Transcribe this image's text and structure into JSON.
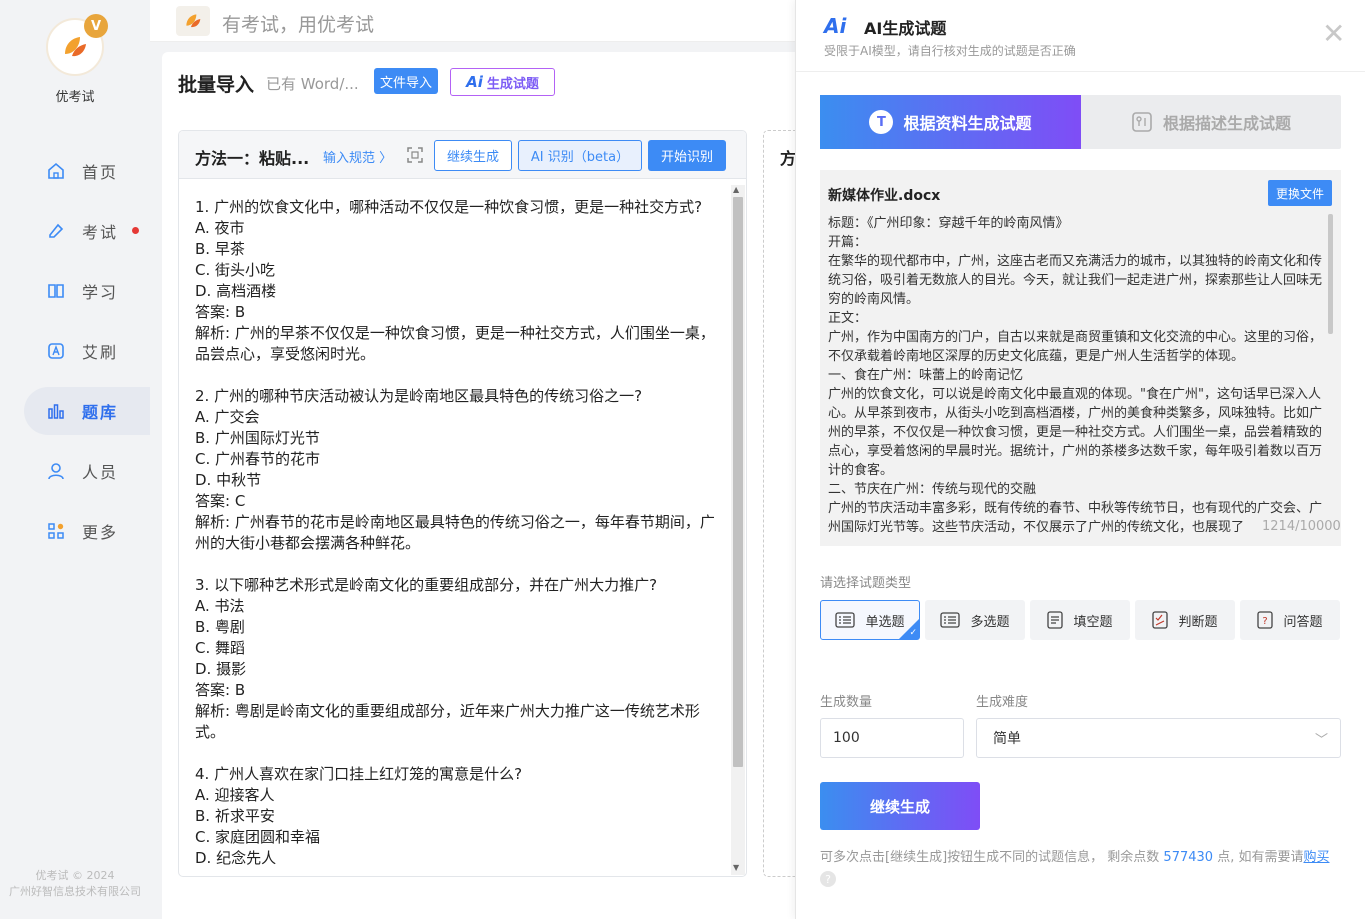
{
  "app": {
    "name": "优考试",
    "slogan": "有考试，用优考试"
  },
  "sidebar": {
    "items": [
      {
        "label": "首页",
        "icon": "home-icon"
      },
      {
        "label": "考试",
        "icon": "exam-icon",
        "dot": true
      },
      {
        "label": "学习",
        "icon": "book-icon"
      },
      {
        "label": "艾刷",
        "icon": "practice-icon"
      },
      {
        "label": "题库",
        "icon": "chart-icon",
        "active": true
      },
      {
        "label": "人员",
        "icon": "user-icon"
      },
      {
        "label": "更多",
        "icon": "more-icon"
      }
    ],
    "footer_copyright": "优考试 © 2024",
    "footer_company": "广州好智信息技术有限公司"
  },
  "main": {
    "title": "批量导入",
    "subtitle": "已有 Word/...",
    "import_button": "文件导入",
    "ai_button": "生成试题",
    "method1": {
      "title": "方法一：粘贴...",
      "spec_link": "输入规范 〉",
      "continue_button": "继续生成",
      "ai_recognize_button": "AI 识别（beta）",
      "start_button": "开始识别",
      "lines": [
        "1. 广州的饮食文化中，哪种活动不仅仅是一种饮食习惯，更是一种社交方式?",
        "A. 夜市",
        "B. 早茶",
        "C. 街头小吃",
        "D. 高档酒楼",
        "答案: B",
        "解析: 广州的早茶不仅仅是一种饮食习惯，更是一种社交方式，人们围坐一桌，品尝点心，享受悠闲时光。",
        "",
        "2. 广州的哪种节庆活动被认为是岭南地区最具特色的传统习俗之一?",
        "A. 广交会",
        "B. 广州国际灯光节",
        "C. 广州春节的花市",
        "D. 中秋节",
        "答案: C",
        "解析: 广州春节的花市是岭南地区最具特色的传统习俗之一，每年春节期间，广州的大街小巷都会摆满各种鲜花。",
        "",
        "3. 以下哪种艺术形式是岭南文化的重要组成部分，并在广州大力推广?",
        "A. 书法",
        "B. 粤剧",
        "C. 舞蹈",
        "D. 摄影",
        "答案: B",
        "解析: 粤剧是岭南文化的重要组成部分，近年来广州大力推广这一传统艺术形式。",
        "",
        "4. 广州人喜欢在家门口挂上红灯笼的寓意是什么?",
        "A. 迎接客人",
        "B. 祈求平安",
        "C. 家庭团圆和幸福",
        "D. 纪念先人"
      ]
    },
    "method2_title": "方"
  },
  "drawer": {
    "title": "AI生成试题",
    "subtitle": "受限于AI模型，请自行核对生成的试题是否正确",
    "close": "✕",
    "tabs": [
      {
        "label": "根据资料生成试题",
        "active": true
      },
      {
        "label": "根据描述生成试题",
        "active": false
      }
    ],
    "file": {
      "name": "新媒体作业.docx",
      "change_button": "更换文件",
      "content": [
        "标题：《广州印象：穿越千年的岭南风情》",
        "开篇：",
        "在繁华的现代都市中，广州，这座古老而又充满活力的城市，以其独特的岭南文化和传统习俗，吸引着无数旅人的目光。今天，就让我们一起走进广州，探索那些让人回味无穷的岭南风情。",
        "正文：",
        "广州，作为中国南方的门户，自古以来就是商贸重镇和文化交流的中心。这里的习俗，不仅承载着岭南地区深厚的历史文化底蕴，更是广州人生活哲学的体现。",
        "一、食在广州：味蕾上的岭南记忆",
        "广州的饮食文化，可以说是岭南文化中最直观的体现。\"食在广州\"，这句话早已深入人心。从早茶到夜市，从街头小吃到高档酒楼，广州的美食种类繁多，风味独特。比如广州的早茶，不仅仅是一种饮食习惯，更是一种社交方式。人们围坐一桌，品尝着精致的点心，享受着悠闲的早晨时光。据统计，广州的茶楼多达数千家，每年吸引着数以百万计的食客。",
        "二、节庆在广州：传统与现代的交融",
        "广州的节庆活动丰富多彩，既有传统的春节、中秋等传统节日，也有现代的广交会、广州国际灯光节等。这些节庆活动，不仅展示了广州的传统文化，也展现了"
      ],
      "count": "1214/10000"
    },
    "type_label": "请选择试题类型",
    "types": [
      {
        "label": "单选题",
        "icon": "single-choice-icon",
        "selected": true
      },
      {
        "label": "多选题",
        "icon": "multi-choice-icon",
        "selected": false
      },
      {
        "label": "填空题",
        "icon": "fill-blank-icon",
        "selected": false
      },
      {
        "label": "判断题",
        "icon": "judge-icon",
        "selected": false
      },
      {
        "label": "问答题",
        "icon": "qa-icon",
        "selected": false
      }
    ],
    "count_label": "生成数量",
    "count_value": "100",
    "difficulty_label": "生成难度",
    "difficulty_value": "简单",
    "generate_button": "继续生成",
    "hint_prefix": "可多次点击[继续生成]按钮生成不同的试题信息，  剩余点数 ",
    "points": "577430",
    "hint_suffix": " 点, 如有需要请",
    "buy_link": "购买"
  },
  "colors": {
    "primary": "#3d8bf5",
    "gradient_start": "#3b8ef0",
    "gradient_end": "#7f4df6",
    "alert": "#e53935"
  }
}
